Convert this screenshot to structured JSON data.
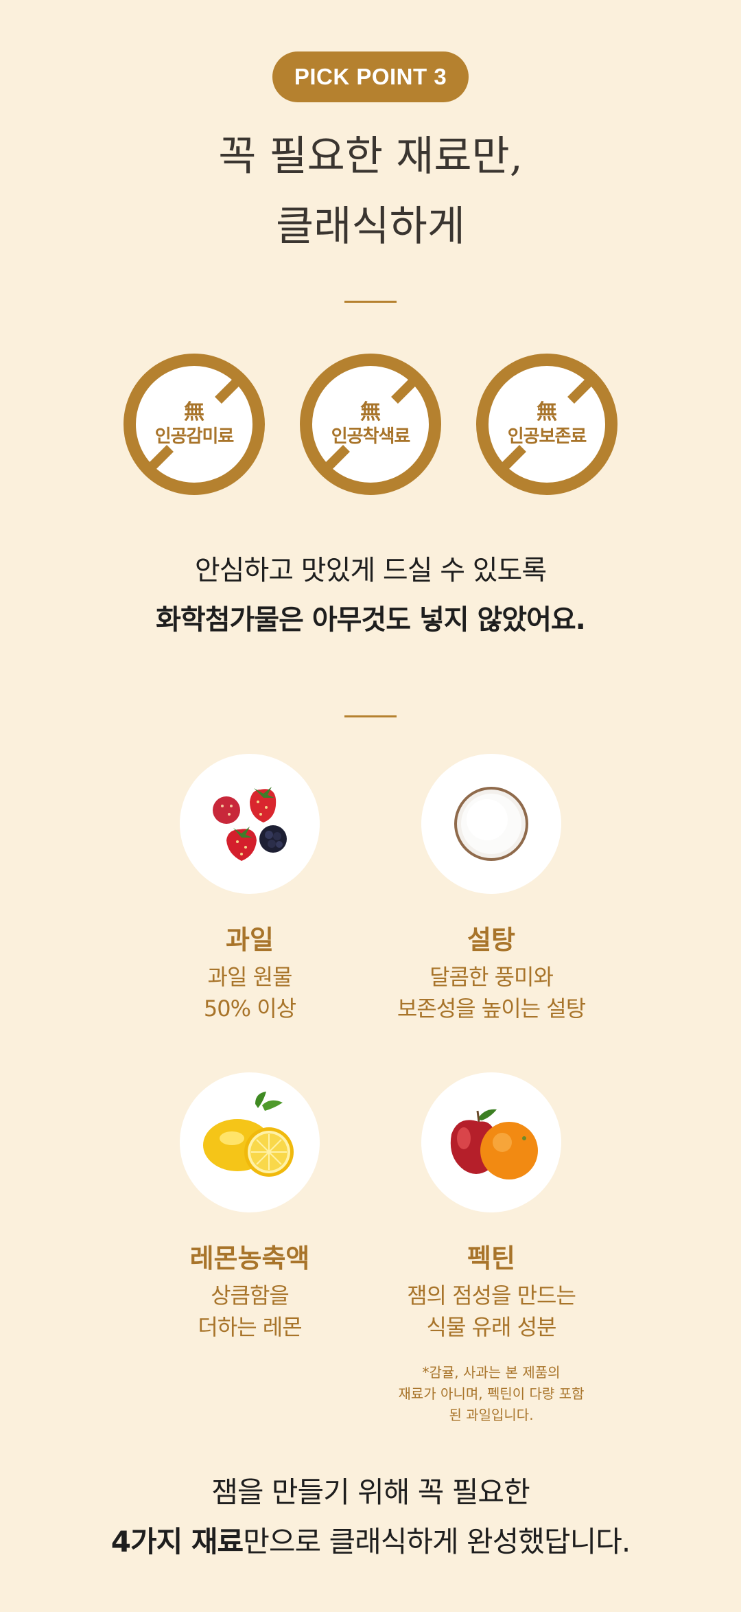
{
  "badge": "PICK POINT 3",
  "headline": {
    "line1": "꼭 필요한 재료만,",
    "line2": "클래식하게"
  },
  "no_additives": [
    {
      "mark": "無",
      "label": "인공감미료"
    },
    {
      "mark": "無",
      "label": "인공착색료"
    },
    {
      "mark": "無",
      "label": "인공보존료"
    }
  ],
  "reassure": {
    "line1": "안심하고 맛있게 드실 수 있도록",
    "line2": "화학첨가물은 아무것도 넣지 않았어요."
  },
  "ingredients": [
    {
      "icon": "berries-icon",
      "title": "과일",
      "desc1": "과일 원물",
      "desc2": "50% 이상"
    },
    {
      "icon": "sugar-bowl-icon",
      "title": "설탕",
      "desc1": "달콤한 풍미와",
      "desc2": "보존성을 높이는 설탕"
    },
    {
      "icon": "lemon-icon",
      "title": "레몬농축액",
      "desc1": "상큼함을",
      "desc2": "더하는 레몬"
    },
    {
      "icon": "apple-orange-icon",
      "title": "펙틴",
      "desc1": "잼의 점성을 만드는",
      "desc2": "식물 유래 성분"
    }
  ],
  "pectin_note": {
    "line1": "*감귤, 사과는 본 제품의",
    "line2": "재료가 아니며, 펙틴이 다량 포함",
    "line3": "된 과일입니다."
  },
  "closing": {
    "line1": "잼을 만들기 위해 꼭 필요한",
    "line2_bold": "4가지 재료",
    "line2_rest": "만으로 클래식하게 완성했답니다."
  },
  "colors": {
    "background": "#fbf0dc",
    "accent": "#b5812f",
    "text": "#1e1e1e"
  }
}
